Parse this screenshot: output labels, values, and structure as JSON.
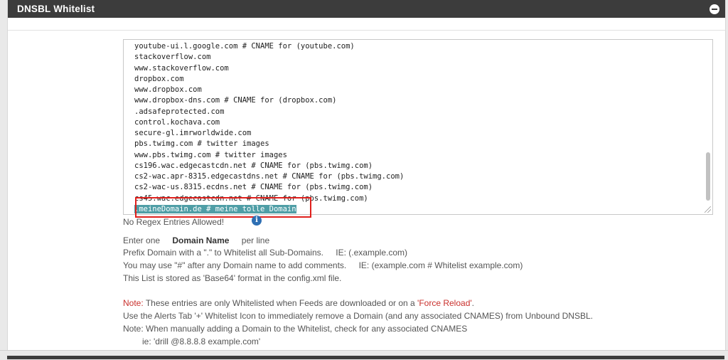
{
  "panel": {
    "title": "DNSBL Whitelist"
  },
  "whitelist": {
    "lines": [
      "youtube-ui.l.google.com # CNAME for (youtube.com)",
      "stackoverflow.com",
      "www.stackoverflow.com",
      "dropbox.com",
      "www.dropbox.com",
      "www.dropbox-dns.com # CNAME for (dropbox.com)",
      ".adsafeprotected.com",
      "control.kochava.com",
      "secure-gl.imrworldwide.com",
      "pbs.twimg.com # twitter images",
      "www.pbs.twimg.com # twitter images",
      "cs196.wac.edgecastcdn.net # CNAME for (pbs.twimg.com)",
      "cs2-wac.apr-8315.edgecastdns.net # CNAME for (pbs.twimg.com)",
      "cs2-wac-us.8315.ecdns.net # CNAME for (pbs.twimg.com)",
      "cs45.wac.edgecastcdn.net # CNAME for (pbs.twimg.com)"
    ],
    "highlighted_line": ".meineDomain.de # meine tolle Domain"
  },
  "help": {
    "no_regex": "No Regex Entries Allowed!",
    "enter_one_pre": "Enter one",
    "enter_one_bold": "Domain Name",
    "enter_one_post": "per line",
    "prefix": "Prefix Domain with a \".\" to Whitelist all Sub-Domains.",
    "prefix_example": "IE: (.example.com)",
    "hash": "You may use \"#\" after any Domain name to add comments.",
    "hash_example": "IE: (example.com # Whitelist example.com)",
    "stored": "This List is stored as 'Base64' format in the config.xml file.",
    "note_label": "Note:",
    "note_text": "These entries are only Whitelisted when Feeds are downloaded or on a",
    "note_link": "'Force Reload'",
    "note_end": ".",
    "alerts": "Use the Alerts Tab '+' Whitelist Icon to immediately remove a Domain (and any associated CNAMES) from Unbound DNSBL.",
    "manual": "Note: When manually adding a Domain to the Whitelist, check for any associated CNAMES",
    "drill": "ie: 'drill @8.8.8.8 example.com'"
  },
  "colors": {
    "header_bg": "#3c3c3c",
    "highlight_bg": "#4f9ea6",
    "annotation_red": "#e0201c",
    "note_red": "#c9302c",
    "info_blue": "#2e6fb3"
  },
  "icons": {
    "collapse": "minus-circle-icon",
    "info": "info-circle-icon"
  }
}
